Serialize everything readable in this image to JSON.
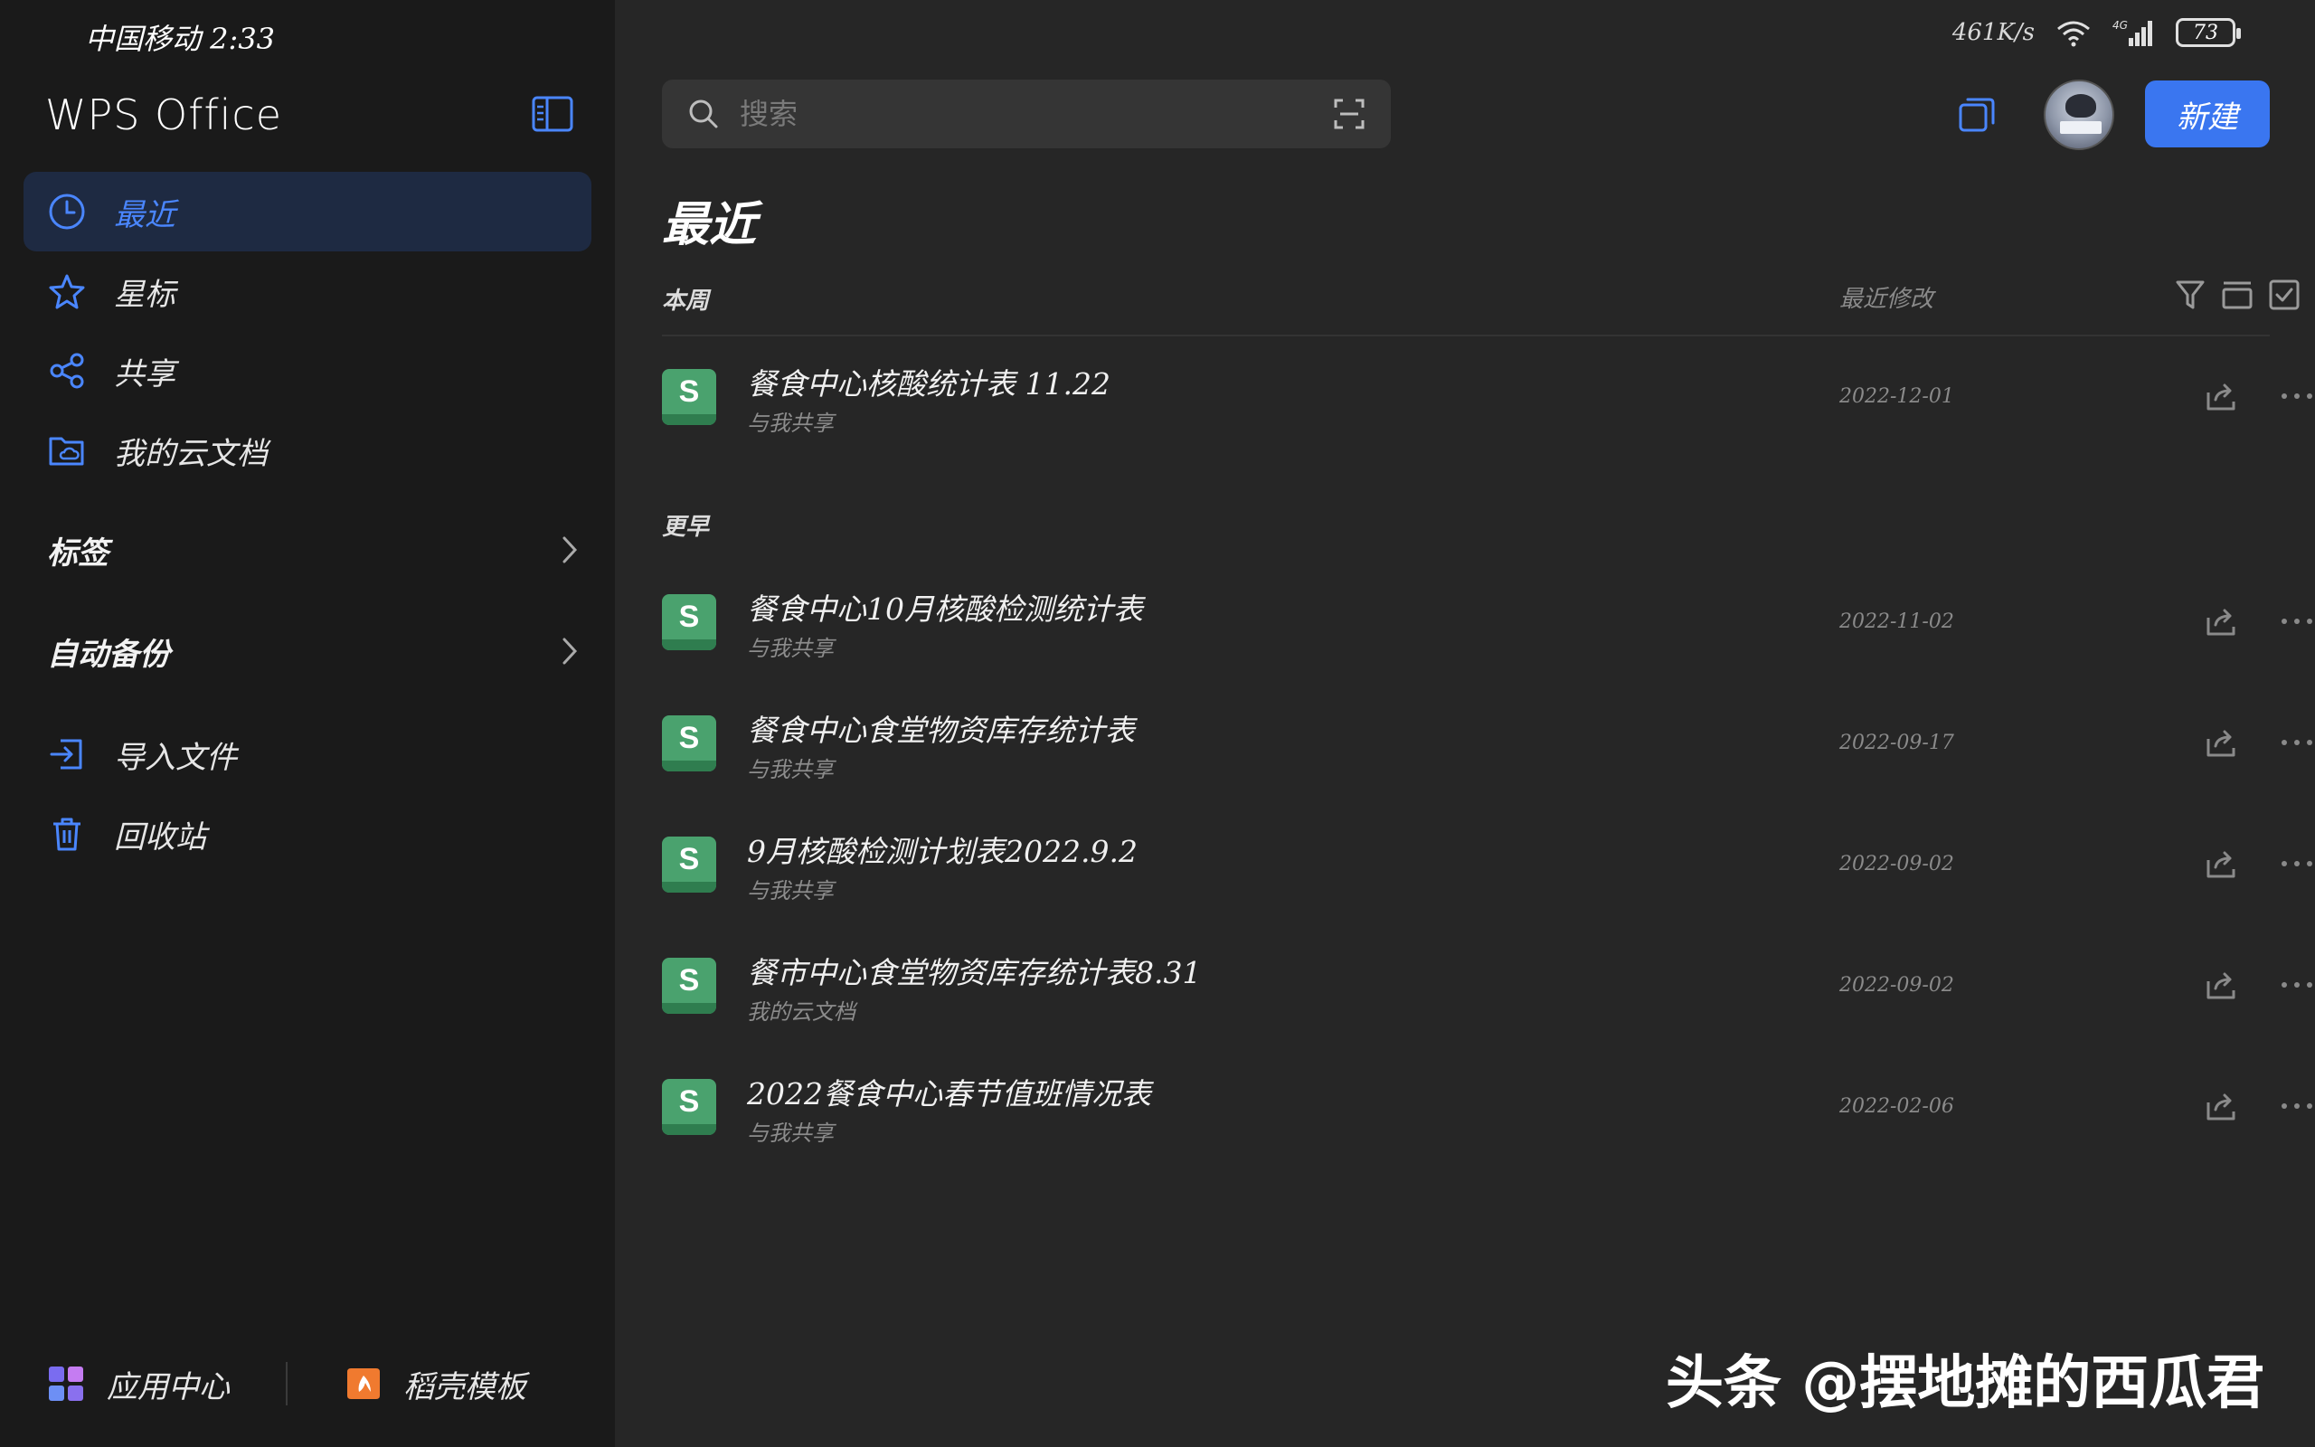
{
  "status_bar": {
    "carrier_time": "中国移动 2:33",
    "net_speed": "461K/s",
    "battery": "73"
  },
  "sidebar": {
    "logo": "WPS Office",
    "nav": [
      {
        "label": "最近",
        "icon": "clock-icon",
        "active": true
      },
      {
        "label": "星标",
        "icon": "star-icon",
        "active": false
      },
      {
        "label": "共享",
        "icon": "share-nodes-icon",
        "active": false
      },
      {
        "label": "我的云文档",
        "icon": "cloud-folder-icon",
        "active": false
      }
    ],
    "sections": [
      {
        "label": "标签"
      },
      {
        "label": "自动备份"
      }
    ],
    "tools": [
      {
        "label": "导入文件",
        "icon": "import-icon"
      },
      {
        "label": "回收站",
        "icon": "trash-icon"
      }
    ],
    "bottom": [
      {
        "label": "应用中心",
        "icon": "apps-grid-icon"
      },
      {
        "label": "稻壳模板",
        "icon": "docer-icon"
      }
    ]
  },
  "header": {
    "search_placeholder": "搜索",
    "new_button": "新建"
  },
  "main": {
    "title": "最近",
    "column_modified": "最近修改",
    "groups": [
      {
        "label": "本周",
        "files": [
          {
            "name": "餐食中心核酸统计表 11.22",
            "location": "与我共享",
            "date": "2022-12-01",
            "type": "S"
          }
        ]
      },
      {
        "label": "更早",
        "files": [
          {
            "name": "餐食中心10月核酸检测统计表",
            "location": "与我共享",
            "date": "2022-11-02",
            "type": "S"
          },
          {
            "name": "餐食中心食堂物资库存统计表",
            "location": "与我共享",
            "date": "2022-09-17",
            "type": "S"
          },
          {
            "name": "9月核酸检测计划表2022.9.2",
            "location": "与我共享",
            "date": "2022-09-02",
            "type": "S"
          },
          {
            "name": "餐市中心食堂物资库存统计表8.31",
            "location": "我的云文档",
            "date": "2022-09-02",
            "type": "S"
          },
          {
            "name": "2022餐食中心春节值班情况表",
            "location": "与我共享",
            "date": "2022-02-06",
            "type": "S"
          }
        ]
      }
    ]
  },
  "watermark": {
    "brand": "头条",
    "handle": "@摆地摊的西瓜君"
  },
  "colors": {
    "accent": "#3a76f0",
    "active_bg": "#1e2a42",
    "sheet_green": "#4aa26e",
    "sidebar_bg": "#1a1a1a",
    "main_bg": "#262626"
  }
}
